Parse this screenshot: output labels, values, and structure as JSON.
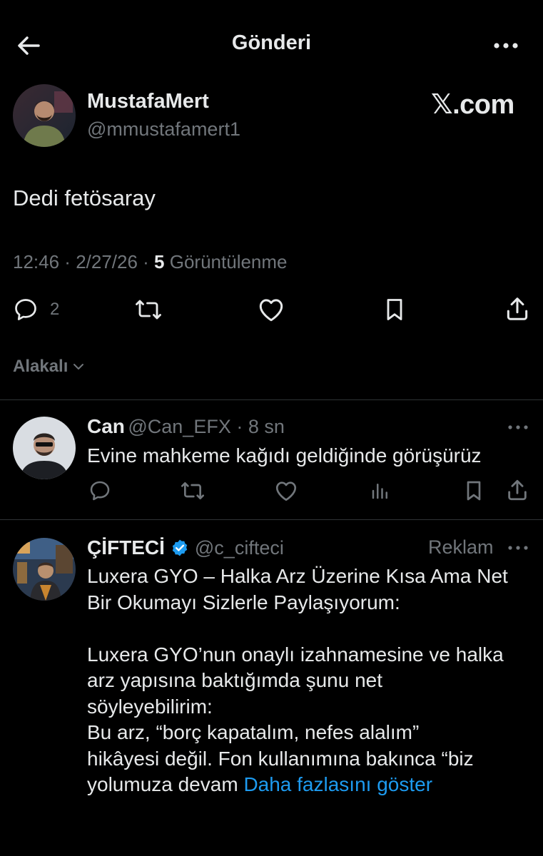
{
  "header": {
    "title": "Gönderi"
  },
  "main_tweet": {
    "author_name": "MustafaMert",
    "author_handle": "@mmustafamert1",
    "watermark": "𝕏.com",
    "text": "Dedi fetösaray",
    "time": "12:46",
    "date": "2/27/26",
    "views_count": "5",
    "views_label": "Görüntülenme",
    "reply_count": "2"
  },
  "filter": {
    "label": "Alakalı"
  },
  "replies": [
    {
      "name": "Can",
      "handle": "@Can_EFX",
      "time": "8 sn",
      "text": "Evine mahkeme kağıdı geldiğinde görüşürüz"
    },
    {
      "name": "ÇİFTECİ",
      "handle": "@c_cifteci",
      "ad_label": "Reklam",
      "verified": true,
      "lines": [
        "Luxera GYO – Halka Arz Üzerine Kısa Ama Net",
        "Bir Okumayı Sizlerle Paylaşıyorum:",
        "",
        "Luxera GYO’nun onaylı izahnamesine ve halka",
        "arz yapısına baktığımda şunu net",
        "söyleyebilirim:",
        "Bu arz, “borç kapatalım, nefes alalım”",
        "hikâyesi değil. Fon kullanımına bakınca “biz",
        "yolumuza devam "
      ],
      "show_more": "Daha fazlasını göster"
    }
  ],
  "colors": {
    "background": "#000000",
    "text": "#e7e9ea",
    "muted": "#71767b",
    "accent": "#1d9bf0",
    "divider": "#2f3336"
  }
}
